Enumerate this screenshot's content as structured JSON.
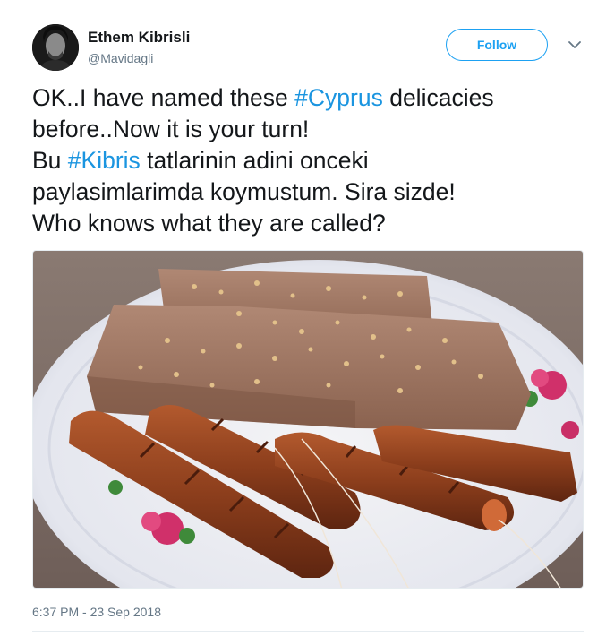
{
  "author": {
    "name": "Ethem Kibrisli",
    "handle": "@Mavidagli"
  },
  "follow_button": {
    "label": "Follow"
  },
  "menu": {
    "icon": "chevron-down-icon"
  },
  "tweet": {
    "lines": [
      {
        "before": "OK..I have named these ",
        "hashtag": "#Cyprus",
        "after": " delicacies"
      },
      {
        "text": "before..Now it is your turn!"
      },
      {
        "before": "Bu ",
        "hashtag": "#Kibris",
        "after": " tatlarinin adini onceki"
      },
      {
        "text": "paylasimlarimda koymustum. Sira sizde!"
      },
      {
        "text": "Who knows what they are called?"
      }
    ]
  },
  "timestamp": "6:37 PM - 23 Sep 2018",
  "colors": {
    "accent": "#1da1f2",
    "hashtag": "#1b95e0",
    "secondary_text": "#657786"
  }
}
